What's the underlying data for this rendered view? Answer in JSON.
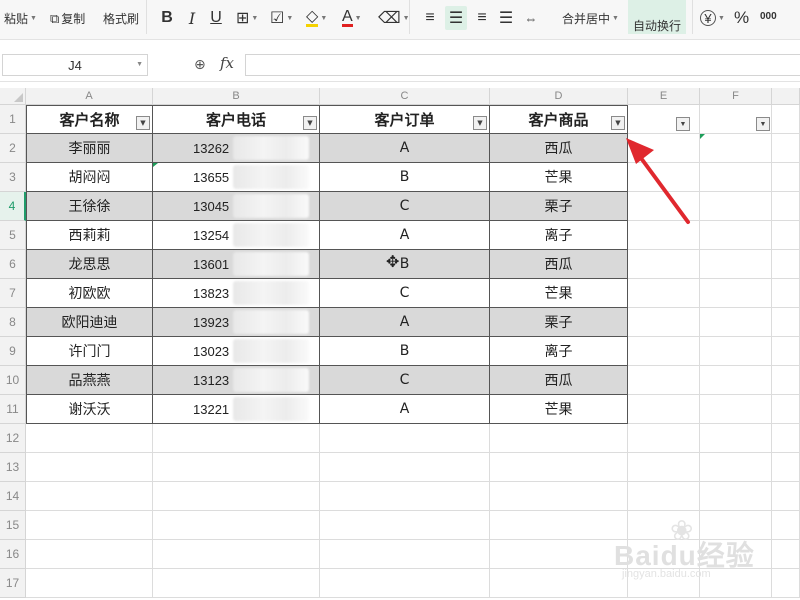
{
  "toolbar": {
    "paste_label": "粘贴",
    "copy_label": "复制",
    "format_painter_label": "格式刷",
    "bold_icon": "B",
    "italic_icon": "I",
    "underline_icon": "U",
    "font_color_icon": "A",
    "merge_center_label": "合并居中",
    "wrap_text_label": "自动换行",
    "currency_icon": "¥",
    "percent_icon": "%",
    "thousands_icon": "000",
    "wrap_highlight_color": "#ddf0e6"
  },
  "formula_bar": {
    "cell_ref": "J4",
    "fx_label": "fx",
    "formula": ""
  },
  "columns": [
    "A",
    "B",
    "C",
    "D",
    "E",
    "F"
  ],
  "rows": [
    "1",
    "2",
    "3",
    "4",
    "5",
    "6",
    "7",
    "8",
    "9",
    "10",
    "11",
    "12",
    "13",
    "14",
    "15",
    "16",
    "17"
  ],
  "active_row": "4",
  "table": {
    "headers": [
      "客户名称",
      "客户电话",
      "客户订单",
      "客户商品"
    ],
    "data": [
      {
        "name": "李丽丽",
        "phone": "13262",
        "order": "A",
        "product": "西瓜"
      },
      {
        "name": "胡闷闷",
        "phone": "13655",
        "order": "B",
        "product": "芒果"
      },
      {
        "name": "王徐徐",
        "phone": "13045",
        "order": "C",
        "product": "栗子"
      },
      {
        "name": "西莉莉",
        "phone": "13254",
        "order": "A",
        "product": "离子"
      },
      {
        "name": "龙思思",
        "phone": "13601",
        "order": "B",
        "product": "西瓜"
      },
      {
        "name": "初欧欧",
        "phone": "13823",
        "order": "C",
        "product": "芒果"
      },
      {
        "name": "欧阳迪迪",
        "phone": "13923",
        "order": "A",
        "product": "栗子"
      },
      {
        "name": "许门门",
        "phone": "13023",
        "order": "B",
        "product": "离子"
      },
      {
        "name": "品燕燕",
        "phone": "13123",
        "order": "C",
        "product": "西瓜"
      },
      {
        "name": "谢沃沃",
        "phone": "13221",
        "order": "A",
        "product": "芒果"
      }
    ],
    "shade_color": "#d9d9d9"
  },
  "annotation": {
    "arrow_color": "#e0282e"
  },
  "watermark": {
    "brand": "Baidu经验",
    "url": "jingyan.baidu.com"
  }
}
